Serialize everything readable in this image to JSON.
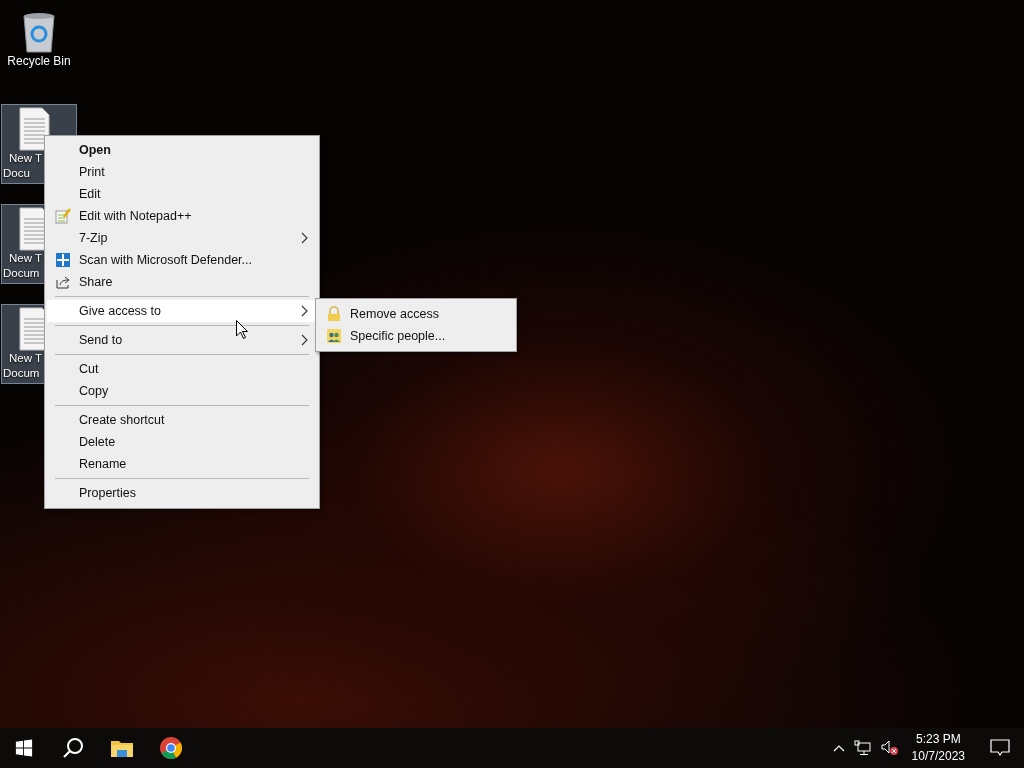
{
  "desktop_icons": [
    {
      "kind": "recycle-bin",
      "lines": [
        "Recycle Bin"
      ],
      "selected": false
    },
    {
      "kind": "document",
      "lines": [
        "New T",
        "Docu"
      ],
      "selected": true
    },
    {
      "kind": "document",
      "lines": [
        "New T",
        "Docum"
      ],
      "selected": true
    },
    {
      "kind": "document",
      "lines": [
        "New T",
        "Docum"
      ],
      "selected": true
    }
  ],
  "context_menu": {
    "items": [
      {
        "kind": "item",
        "label": "Open",
        "bold": true,
        "highlighted": false,
        "submenu": false
      },
      {
        "kind": "item",
        "label": "Print",
        "bold": false,
        "highlighted": false,
        "submenu": false
      },
      {
        "kind": "item",
        "label": "Edit",
        "bold": false,
        "highlighted": false,
        "submenu": false
      },
      {
        "kind": "notepad-item",
        "label": "Edit with Notepad++",
        "bold": false,
        "highlighted": false,
        "submenu": false
      },
      {
        "kind": "item",
        "label": "7-Zip",
        "bold": false,
        "highlighted": false,
        "submenu": true
      },
      {
        "kind": "shield-item",
        "label": "Scan with Microsoft Defender...",
        "bold": false,
        "highlighted": false,
        "submenu": false
      },
      {
        "kind": "share-item",
        "label": "Share",
        "bold": false,
        "highlighted": false,
        "submenu": false
      },
      {
        "kind": "separator"
      },
      {
        "kind": "item",
        "label": "Give access to",
        "bold": false,
        "highlighted": true,
        "submenu": true
      },
      {
        "kind": "separator"
      },
      {
        "kind": "item",
        "label": "Send to",
        "bold": false,
        "highlighted": false,
        "submenu": true
      },
      {
        "kind": "separator"
      },
      {
        "kind": "item",
        "label": "Cut",
        "bold": false,
        "highlighted": false,
        "submenu": false
      },
      {
        "kind": "item",
        "label": "Copy",
        "bold": false,
        "highlighted": false,
        "submenu": false
      },
      {
        "kind": "separator"
      },
      {
        "kind": "item",
        "label": "Create shortcut",
        "bold": false,
        "highlighted": false,
        "submenu": false
      },
      {
        "kind": "item",
        "label": "Delete",
        "bold": false,
        "highlighted": false,
        "submenu": false
      },
      {
        "kind": "item",
        "label": "Rename",
        "bold": false,
        "highlighted": false,
        "submenu": false
      },
      {
        "kind": "separator"
      },
      {
        "kind": "item",
        "label": "Properties",
        "bold": false,
        "highlighted": false,
        "submenu": false
      }
    ]
  },
  "submenu": {
    "items": [
      {
        "label": "Remove access"
      },
      {
        "label": "Specific people..."
      }
    ]
  },
  "taskbar": {
    "clock": {
      "time": "5:23 PM",
      "date": "10/7/2023"
    }
  }
}
